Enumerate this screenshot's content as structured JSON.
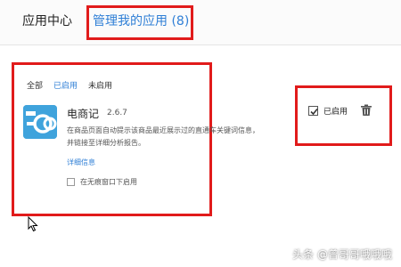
{
  "header": {
    "tab_app_center": "应用中心",
    "tab_manage": "管理我的应用 (8)"
  },
  "filters": {
    "all": "全部",
    "enabled": "已启用",
    "disabled": "未启用"
  },
  "extension": {
    "name": "电商记",
    "version": "2.6.7",
    "description_line1": "在商品页面自动提示该商品最近展示过的直通车关键词信息，",
    "description_line2": "并链接至详细分析报告。",
    "detail_link": "详细信息",
    "incognito_label": "在无痕窗口下启用",
    "enabled_label": "已启用",
    "enabled": true,
    "incognito_enabled": false,
    "icon_color": "#3fa3dc"
  },
  "watermark": {
    "text": "头条 @曾哥哥哦哦哦"
  },
  "colors": {
    "accent": "#2f7fd6",
    "highlight_box": "#e11b1b"
  }
}
